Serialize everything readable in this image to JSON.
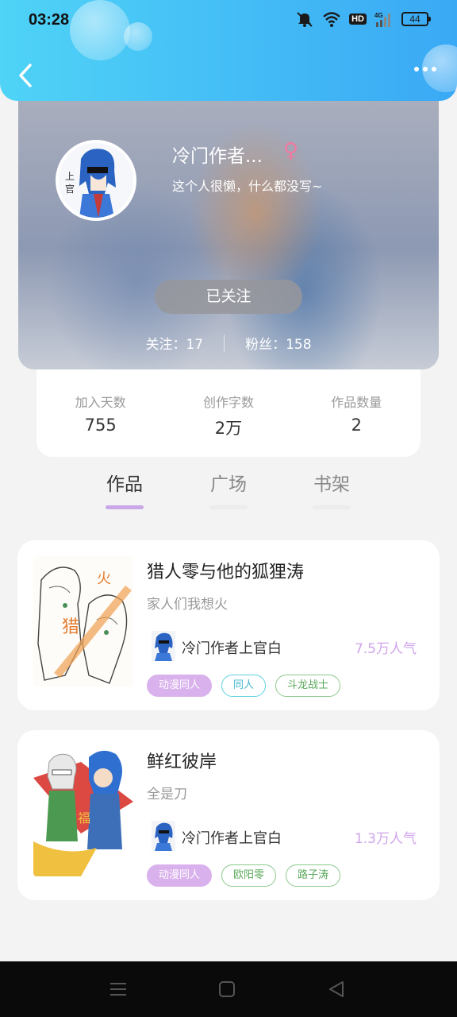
{
  "status_bar": {
    "time": "03:28",
    "hd": "HD",
    "network": "4G",
    "battery": "44"
  },
  "profile": {
    "nickname": "冷门作者...",
    "gender_symbol": "♀",
    "bio": "这个人很懒，什么都没写~",
    "follow_button": "已关注",
    "following": "关注：17",
    "followers": "粉丝：158"
  },
  "stats": [
    {
      "label": "加入天数",
      "value": "755"
    },
    {
      "label": "创作字数",
      "value": "2万"
    },
    {
      "label": "作品数量",
      "value": "2"
    }
  ],
  "tabs": [
    {
      "label": "作品",
      "active": true
    },
    {
      "label": "广场",
      "active": false
    },
    {
      "label": "书架",
      "active": false
    }
  ],
  "works": [
    {
      "title": "猎人零与他的狐狸涛",
      "description": "家人们我想火",
      "author": "冷门作者上官白",
      "popularity": "7.5万人气",
      "tags": [
        "动漫同人",
        "同人",
        "斗龙战士"
      ]
    },
    {
      "title": "鲜红彼岸",
      "description": "全是刀",
      "author": "冷门作者上官白",
      "popularity": "1.3万人气",
      "tags": [
        "动漫同人",
        "欧阳零",
        "路子涛"
      ]
    }
  ],
  "colors": {
    "header_start": "#4fd3f6",
    "header_end": "#3aa9f5",
    "accent_purple": "#d9b1ec",
    "popularity": "#d0a4ea",
    "gender": "#f07aa0"
  },
  "icons": [
    "back-icon",
    "more-icon",
    "mute-icon",
    "wifi-icon",
    "signal-icon",
    "battery-icon",
    "menu-icon",
    "home-icon",
    "back-triangle-icon"
  ]
}
